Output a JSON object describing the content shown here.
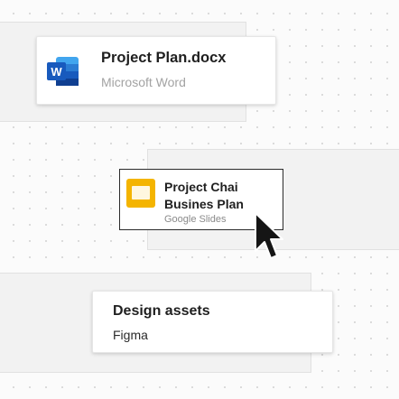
{
  "cards": [
    {
      "id": "word",
      "title": "Project Plan.docx",
      "app": "Microsoft Word",
      "icon": "microsoft-word-icon",
      "icon_letter": "W",
      "app_color": "#a3a3a3"
    },
    {
      "id": "slides",
      "title_line1": "Project Chai",
      "title_line2": "Busines Plan",
      "app": "Google Slides",
      "icon": "google-slides-icon",
      "app_color": "#8a8a8a",
      "selected": true
    },
    {
      "id": "figma",
      "title": "Design assets",
      "app": "Figma",
      "app_color": "#2a2a2a"
    }
  ],
  "colors": {
    "word_blue": "#185abd",
    "word_light": "#41a5ee",
    "slides_yellow": "#f4b400",
    "selection_border": "#2b2b2b",
    "canvas": "#fbfbfb",
    "panel": "#f2f2f2"
  },
  "pointer": {
    "icon": "mouse-pointer-icon"
  }
}
